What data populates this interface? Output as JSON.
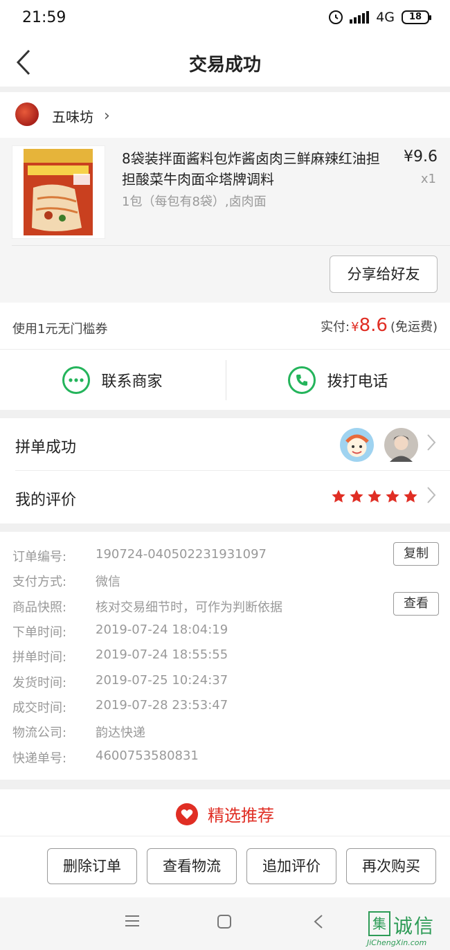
{
  "status": {
    "time": "21:59",
    "network": "4G",
    "battery": "18"
  },
  "nav": {
    "title": "交易成功"
  },
  "shop": {
    "name": "五味坊",
    "chevron": "›"
  },
  "product": {
    "title": "8袋装拌面酱料包炸酱卤肉三鲜麻辣红油担担酸菜牛肉面伞塔牌调料",
    "spec": "1包（每包有8袋）,卤肉面",
    "price": "¥9.6",
    "qty": "x1",
    "share_label": "分享给好友"
  },
  "payment": {
    "coupon": "使用1元无门槛券",
    "paid_label": "实付:",
    "currency": "¥",
    "amount": "8.6",
    "shipping": "(免运费)"
  },
  "contact": {
    "merchant_label": "联系商家",
    "call_label": "拨打电话"
  },
  "group": {
    "success_label": "拼单成功",
    "review_label": "我的评价",
    "rating": 5
  },
  "order_info": {
    "rows": [
      {
        "label": "订单编号:",
        "value": "190724-040502231931097"
      },
      {
        "label": "支付方式:",
        "value": "微信"
      },
      {
        "label": "商品快照:",
        "value": "核对交易细节时，可作为判断依据"
      },
      {
        "label": "下单时间:",
        "value": "2019-07-24 18:04:19"
      },
      {
        "label": "拼单时间:",
        "value": "2019-07-24 18:55:55"
      },
      {
        "label": "发货时间:",
        "value": "2019-07-25 10:24:37"
      },
      {
        "label": "成交时间:",
        "value": "2019-07-28 23:53:47"
      },
      {
        "label": "物流公司:",
        "value": "韵达快递"
      },
      {
        "label": "快递单号:",
        "value": "4600753580831"
      }
    ],
    "copy_label": "复制",
    "view_label": "查看"
  },
  "recommend": {
    "label": "精选推荐"
  },
  "actions": {
    "delete": "删除订单",
    "logistics": "查看物流",
    "add_review": "追加评价",
    "rebuy": "再次购买"
  },
  "watermark": {
    "text": "诚信",
    "box": "集",
    "sub": "JiChengXin.com"
  },
  "colors": {
    "accent": "#e02e24",
    "green": "#24b45b",
    "gray_bg": "#f0f0f0"
  }
}
